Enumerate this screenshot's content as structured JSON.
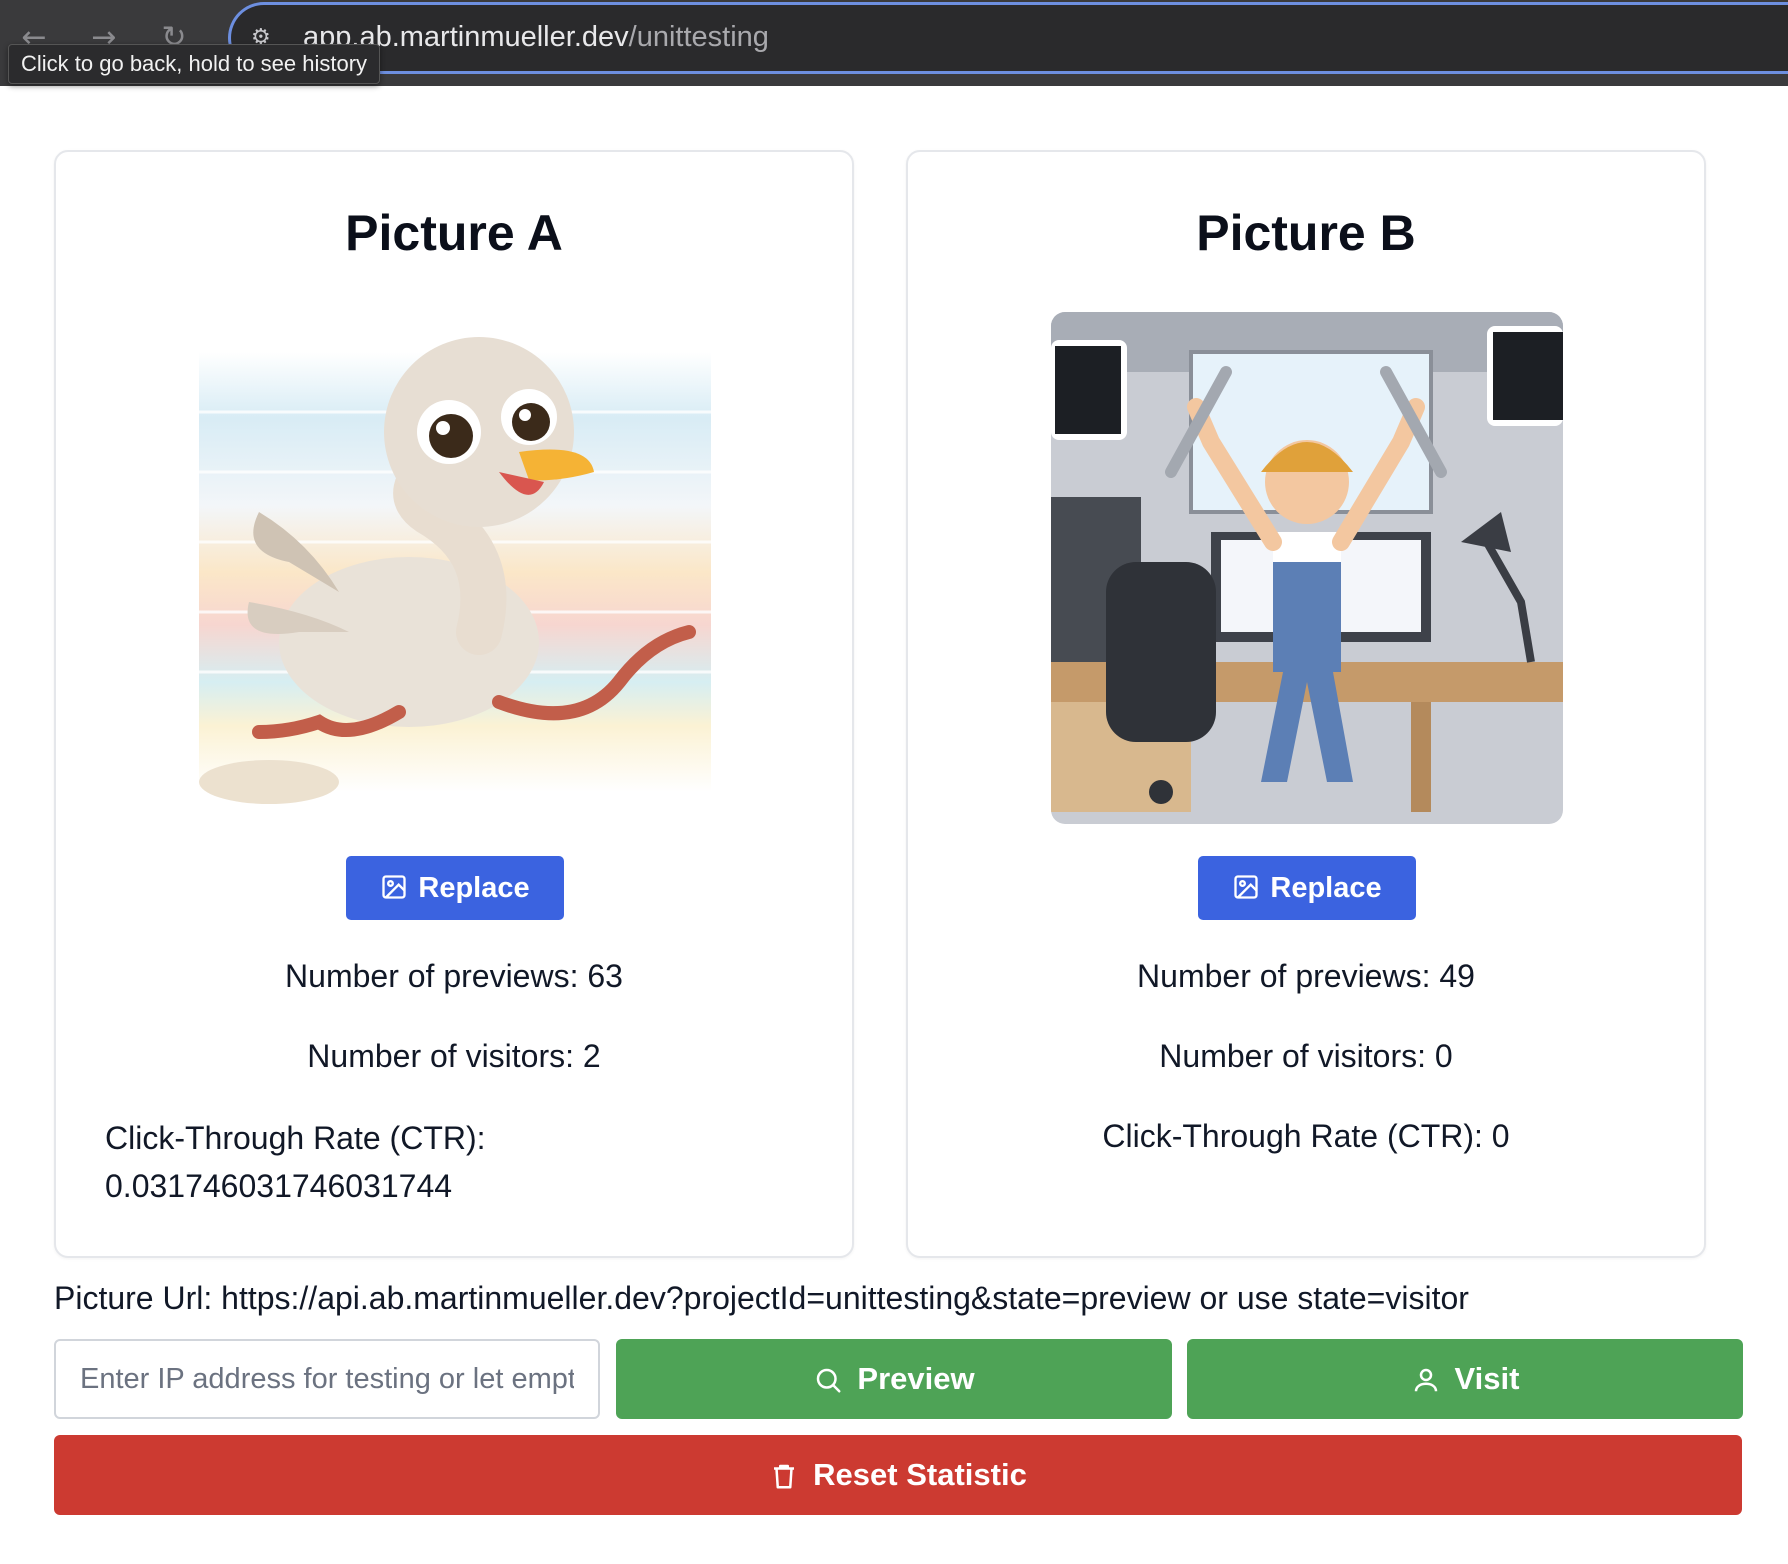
{
  "browser": {
    "url_host": "app.ab.martinmueller.dev",
    "url_path": "/unittesting",
    "tooltip": "Click to go back, hold to see history"
  },
  "cards": [
    {
      "title": "Picture A",
      "image_icon": "ostrich-illustration",
      "replace_label": "Replace",
      "previews": "Number of previews: 63",
      "visitors": "Number of visitors: 2",
      "ctr": "Click-Through Rate (CTR): 0.031746031746031744"
    },
    {
      "title": "Picture B",
      "image_icon": "developer-with-wrenches-illustration",
      "replace_label": "Replace",
      "previews": "Number of previews: 49",
      "visitors": "Number of visitors: 0",
      "ctr": "Click-Through Rate (CTR): 0"
    }
  ],
  "picture_url": "Picture Url: https://api.ab.martinmueller.dev?projectId=unittesting&state=preview or use state=visitor",
  "ip_input": {
    "placeholder": "Enter IP address for testing or let empty",
    "value": ""
  },
  "actions": {
    "preview_label": "Preview",
    "visit_label": "Visit",
    "reset_label": "Reset Statistic"
  },
  "colors": {
    "primary": "#3b63e0",
    "success": "#4ea356",
    "danger": "#cc3a31"
  }
}
